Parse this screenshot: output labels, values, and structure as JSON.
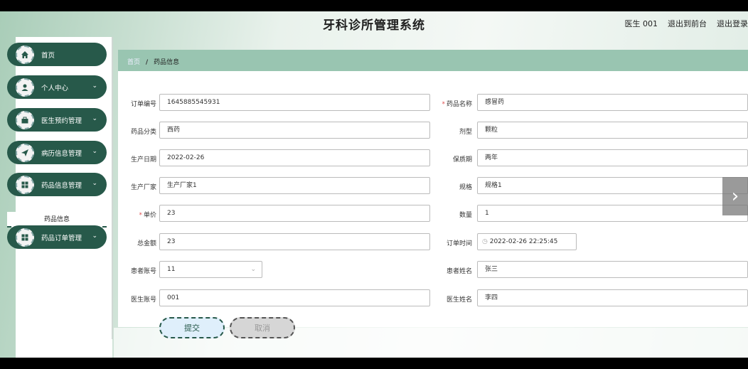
{
  "header": {
    "app_title": "牙科诊所管理系统",
    "user_label": "医生 001",
    "back_front_label": "退出到前台",
    "logout_label": "退出登录"
  },
  "sidebar": {
    "items": [
      {
        "label": "首页",
        "icon": "home-icon"
      },
      {
        "label": "个人中心",
        "icon": "user-icon"
      },
      {
        "label": "医生预约管理",
        "icon": "briefcase-icon"
      },
      {
        "label": "病历信息管理",
        "icon": "send-icon"
      },
      {
        "label": "药品信息管理",
        "icon": "grid-icon"
      },
      {
        "label": "药品订单管理",
        "icon": "grid-icon"
      }
    ],
    "sub_item": "药品信息"
  },
  "breadcrumb": {
    "home": "首页",
    "separator": "/",
    "current": "药品信息"
  },
  "form": {
    "order_no": {
      "label": "订单编号",
      "value": "1645885545931"
    },
    "drug_name": {
      "label": "药品名称",
      "value": "感冒药",
      "required": true
    },
    "category": {
      "label": "药品分类",
      "value": "西药"
    },
    "dosage_form": {
      "label": "剂型",
      "value": "颗粒"
    },
    "production_date": {
      "label": "生产日期",
      "value": "2022-02-26"
    },
    "shelf_life": {
      "label": "保质期",
      "value": "两年"
    },
    "manufacturer": {
      "label": "生产厂家",
      "value": "生产厂家1"
    },
    "spec": {
      "label": "规格",
      "value": "规格1"
    },
    "unit_price": {
      "label": "单价",
      "value": "23",
      "required": true
    },
    "quantity": {
      "label": "数量",
      "value": "1"
    },
    "total_amount": {
      "label": "总金额",
      "value": "23"
    },
    "order_time": {
      "label": "订单时间",
      "value": "2022-02-26 22:25:45"
    },
    "patient_account": {
      "label": "患者账号",
      "value": "11"
    },
    "patient_name": {
      "label": "患者姓名",
      "value": "张三"
    },
    "doctor_account": {
      "label": "医生账号",
      "value": "001"
    },
    "doctor_name": {
      "label": "医生姓名",
      "value": "李四"
    }
  },
  "buttons": {
    "submit": "提交",
    "cancel": "取消"
  },
  "colors": {
    "nav_bg": "#27594a",
    "breadcrumb_bg": "#99c5b1",
    "required": "#e05353"
  }
}
